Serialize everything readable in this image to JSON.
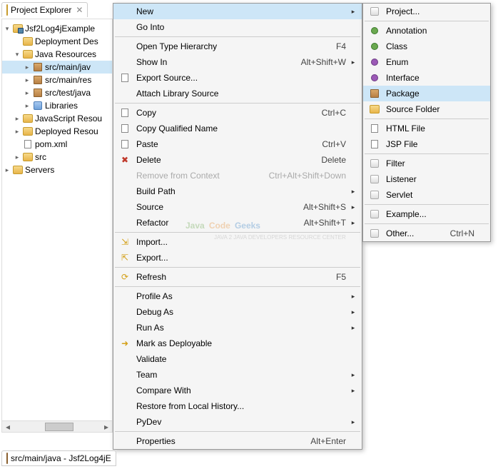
{
  "view": {
    "title": "Project Explorer",
    "close_glyph": "✕"
  },
  "tree": [
    {
      "indent": 0,
      "twisty": "▾",
      "icon": "proj",
      "label": "Jsf2Log4jExample"
    },
    {
      "indent": 1,
      "twisty": "",
      "icon": "folder",
      "label": "Deployment Des"
    },
    {
      "indent": 1,
      "twisty": "▾",
      "icon": "folder",
      "label": "Java Resources"
    },
    {
      "indent": 2,
      "twisty": "▸",
      "icon": "package",
      "label": "src/main/jav",
      "selected": true
    },
    {
      "indent": 2,
      "twisty": "▸",
      "icon": "package",
      "label": "src/main/res"
    },
    {
      "indent": 2,
      "twisty": "▸",
      "icon": "package",
      "label": "src/test/java"
    },
    {
      "indent": 2,
      "twisty": "▸",
      "icon": "lib",
      "label": "Libraries"
    },
    {
      "indent": 1,
      "twisty": "▸",
      "icon": "folder",
      "label": "JavaScript Resou"
    },
    {
      "indent": 1,
      "twisty": "▸",
      "icon": "folder",
      "label": "Deployed Resou"
    },
    {
      "indent": 1,
      "twisty": "",
      "icon": "xml",
      "label": "pom.xml"
    },
    {
      "indent": 1,
      "twisty": "▸",
      "icon": "folder",
      "label": "src"
    },
    {
      "indent": 0,
      "twisty": "▸",
      "icon": "folder",
      "label": "Servers"
    }
  ],
  "context_menu": [
    {
      "label": "New",
      "submenu": true,
      "highlight": true
    },
    {
      "label": "Go Into"
    },
    {
      "sep": true
    },
    {
      "label": "Open Type Hierarchy",
      "accel": "F4"
    },
    {
      "label": "Show In",
      "accel": "Alt+Shift+W",
      "submenu": true
    },
    {
      "icon": "file",
      "label": "Export Source..."
    },
    {
      "label": "Attach Library Source"
    },
    {
      "sep": true
    },
    {
      "icon": "file",
      "label": "Copy",
      "accel": "Ctrl+C"
    },
    {
      "icon": "file",
      "label": "Copy Qualified Name"
    },
    {
      "icon": "file",
      "label": "Paste",
      "accel": "Ctrl+V"
    },
    {
      "icon": "red-x",
      "label": "Delete",
      "accel": "Delete"
    },
    {
      "label": "Remove from Context",
      "accel": "Ctrl+Alt+Shift+Down",
      "disabled": true
    },
    {
      "label": "Build Path",
      "submenu": true
    },
    {
      "label": "Source",
      "accel": "Alt+Shift+S",
      "submenu": true
    },
    {
      "label": "Refactor",
      "accel": "Alt+Shift+T",
      "submenu": true
    },
    {
      "sep": true
    },
    {
      "icon": "import",
      "label": "Import..."
    },
    {
      "icon": "export",
      "label": "Export..."
    },
    {
      "sep": true
    },
    {
      "icon": "refresh",
      "label": "Refresh",
      "accel": "F5"
    },
    {
      "sep": true
    },
    {
      "label": "Profile As",
      "submenu": true
    },
    {
      "label": "Debug As",
      "submenu": true
    },
    {
      "label": "Run As",
      "submenu": true
    },
    {
      "icon": "deploy",
      "label": "Mark as Deployable"
    },
    {
      "label": "Validate"
    },
    {
      "label": "Team",
      "submenu": true
    },
    {
      "label": "Compare With",
      "submenu": true
    },
    {
      "label": "Restore from Local History..."
    },
    {
      "label": "PyDev",
      "submenu": true
    },
    {
      "sep": true
    },
    {
      "label": "Properties",
      "accel": "Alt+Enter"
    }
  ],
  "sub_menu": [
    {
      "icon": "wizard",
      "label": "Project..."
    },
    {
      "sep": true
    },
    {
      "icon": "green-at",
      "label": "Annotation"
    },
    {
      "icon": "green-circle",
      "label": "Class"
    },
    {
      "icon": "purple-circle",
      "label": "Enum"
    },
    {
      "icon": "purple-circle",
      "label": "Interface"
    },
    {
      "icon": "package",
      "label": "Package",
      "highlight": true
    },
    {
      "icon": "folder",
      "label": "Source Folder"
    },
    {
      "sep": true
    },
    {
      "icon": "file",
      "label": "HTML File"
    },
    {
      "icon": "file",
      "label": "JSP File"
    },
    {
      "sep": true
    },
    {
      "icon": "wizard",
      "label": "Filter"
    },
    {
      "icon": "wizard",
      "label": "Listener"
    },
    {
      "icon": "wizard",
      "label": "Servlet"
    },
    {
      "sep": true
    },
    {
      "icon": "wizard",
      "label": "Example..."
    },
    {
      "sep": true
    },
    {
      "icon": "wizard",
      "label": "Other...",
      "accel": "Ctrl+N"
    }
  ],
  "watermark": {
    "j": "Java",
    "c": "Code",
    "g": "Geeks",
    "sub": "JAVA 2 JAVA DEVELOPERS RESOURCE CENTER"
  },
  "editor_tab": {
    "label": "src/main/java - Jsf2Log4jE"
  }
}
